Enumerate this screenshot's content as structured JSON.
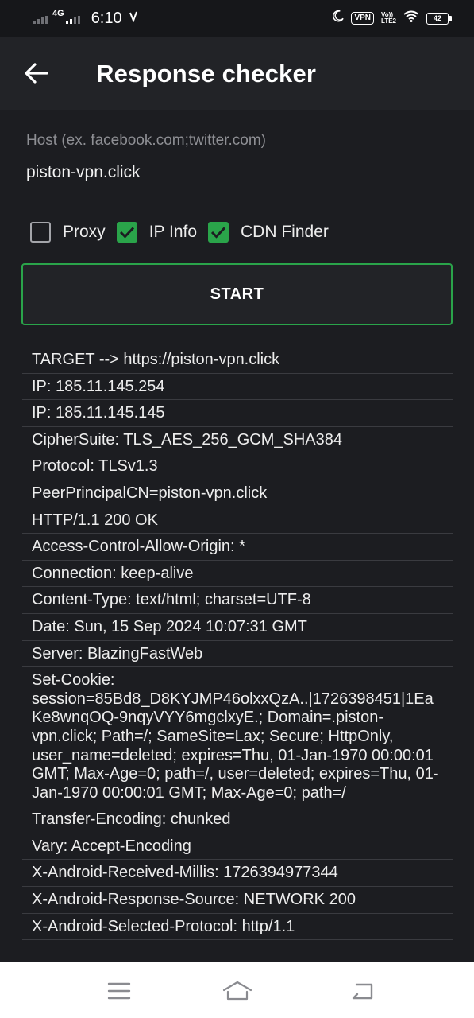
{
  "status_bar": {
    "network": "4G",
    "time": "6:10",
    "vpn": "VPN",
    "volte_top": "Vo))",
    "volte_bottom": "LTE2",
    "battery": "42"
  },
  "toolbar": {
    "title": "Response checker"
  },
  "host": {
    "label": "Host (ex. facebook.com;twitter.com)",
    "value": "piston-vpn.click"
  },
  "options": [
    {
      "label": "Proxy",
      "checked": false
    },
    {
      "label": "IP Info",
      "checked": true
    },
    {
      "label": "CDN Finder",
      "checked": true
    }
  ],
  "start_label": "START",
  "results": [
    "TARGET --> https://piston-vpn.click",
    "IP: 185.11.145.254",
    "IP: 185.11.145.145",
    "CipherSuite: TLS_AES_256_GCM_SHA384",
    "Protocol: TLSv1.3",
    "PeerPrincipalCN=piston-vpn.click",
    "HTTP/1.1 200 OK",
    "Access-Control-Allow-Origin: *",
    "Connection: keep-alive",
    "Content-Type: text/html; charset=UTF-8",
    "Date: Sun, 15 Sep 2024 10:07:31 GMT",
    "Server: BlazingFastWeb",
    "Set-Cookie: session=85Bd8_D8KYJMP46olxxQzA..|1726398451|1EaKe8wnqOQ-9nqyVYY6mgclxyE.; Domain=.piston-vpn.click; Path=/; SameSite=Lax; Secure; HttpOnly, user_name=deleted; expires=Thu, 01-Jan-1970 00:00:01 GMT; Max-Age=0; path=/, user=deleted; expires=Thu, 01-Jan-1970 00:00:01 GMT; Max-Age=0; path=/",
    "Transfer-Encoding: chunked",
    "Vary: Accept-Encoding",
    "X-Android-Received-Millis: 1726394977344",
    "X-Android-Response-Source: NETWORK 200",
    "X-Android-Selected-Protocol: http/1.1"
  ],
  "colors": {
    "accent": "#2aa44a",
    "background": "#1c1d21",
    "toolbar": "#222327"
  },
  "icons": {
    "back": "arrow-left-icon",
    "menu": "menu-icon",
    "home": "home-icon",
    "return": "return-icon"
  }
}
